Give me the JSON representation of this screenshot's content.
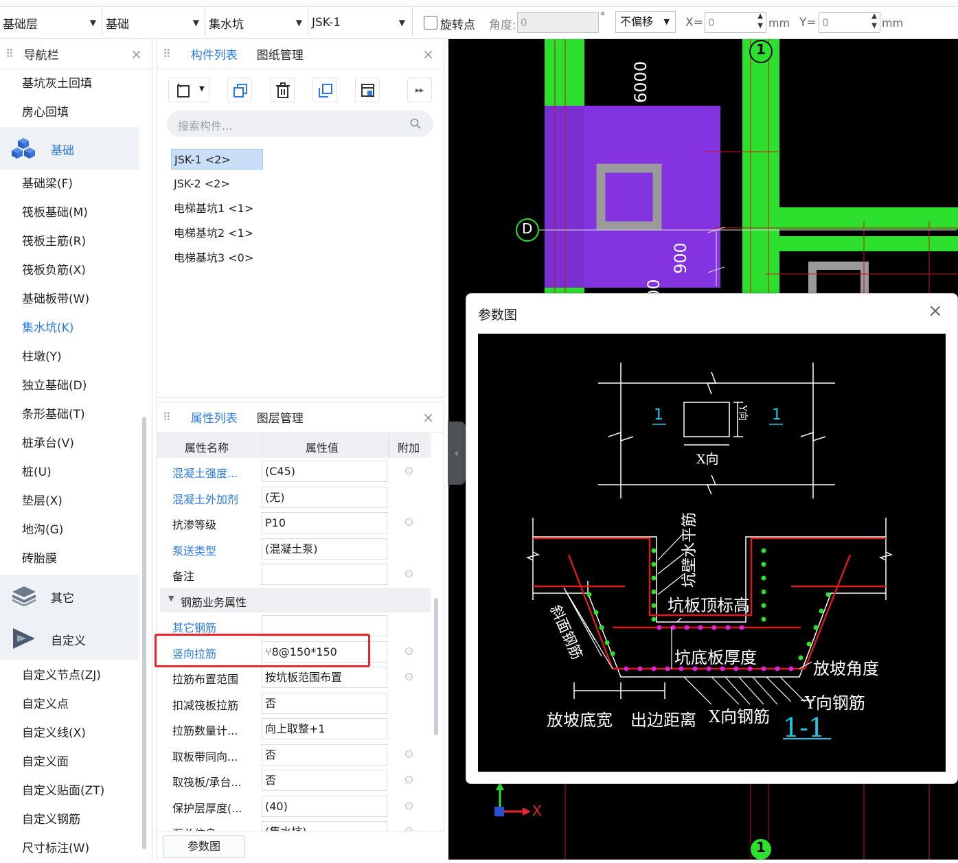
{
  "toolbar": {
    "floor": "基础层",
    "category": "基础",
    "type": "集水坑",
    "component": "JSK-1",
    "rotate_label": "旋转点",
    "angle_label": "角度:",
    "angle_value": "0",
    "degree_symbol": "°",
    "offset_mode": "不偏移",
    "x_label": "X=",
    "x_value": "0",
    "y_label": "Y=",
    "y_value": "0",
    "unit": "mm"
  },
  "nav": {
    "title": "导航栏",
    "items_top": [
      "基坑灰土回填",
      "房心回填"
    ],
    "group_foundation": "基础",
    "foundation_items": [
      "基础梁(F)",
      "筏板基础(M)",
      "筏板主筋(R)",
      "筏板负筋(X)",
      "基础板带(W)",
      "集水坑(K)",
      "柱墩(Y)",
      "独立基础(D)",
      "条形基础(T)",
      "桩承台(V)",
      "桩(U)",
      "垫层(X)",
      "地沟(G)",
      "砖胎膜"
    ],
    "selected_item": "集水坑(K)",
    "group_other": "其它",
    "group_custom": "自定义",
    "custom_items": [
      "自定义节点(ZJ)",
      "自定义点",
      "自定义线(X)",
      "自定义面",
      "自定义贴面(ZT)",
      "自定义钢筋",
      "尺寸标注(W)"
    ]
  },
  "components": {
    "tab_active": "构件列表",
    "tab_other": "图纸管理",
    "search_placeholder": "搜索构件...",
    "items": [
      "JSK-1 <2>",
      "JSK-2 <2>",
      "电梯基坑1 <1>",
      "电梯基坑2 <1>",
      "电梯基坑3 <0>"
    ]
  },
  "properties": {
    "tab_active": "属性列表",
    "tab_other": "图层管理",
    "col_name": "属性名称",
    "col_value": "属性值",
    "col_extra": "附加",
    "rows": [
      {
        "name": "混凝土强度...",
        "value": "(C45)",
        "link": true,
        "dot": true
      },
      {
        "name": "混凝土外加剂",
        "value": "(无)",
        "link": true,
        "dot": false
      },
      {
        "name": "抗渗等级",
        "value": "P10",
        "link": false,
        "dot": true
      },
      {
        "name": "泵送类型",
        "value": "(混凝土泵)",
        "link": true,
        "dot": false
      },
      {
        "name": "备注",
        "value": "",
        "link": false,
        "dot": true
      }
    ],
    "section": "钢筋业务属性",
    "rebar_rows": [
      {
        "name": "其它钢筋",
        "value": "",
        "link": true,
        "dot": false
      },
      {
        "name": "竖向拉筋",
        "value": "⑂8@150*150",
        "link": true,
        "dot": true
      },
      {
        "name": "拉筋布置范围",
        "value": "按坑板范围布置",
        "link": false,
        "dot": true
      },
      {
        "name": "扣减筏板拉筋",
        "value": "否",
        "link": false,
        "dot": false
      },
      {
        "name": "拉筋数量计...",
        "value": "向上取整+1",
        "link": false,
        "dot": false
      },
      {
        "name": "取板带同向...",
        "value": "否",
        "link": false,
        "dot": true
      },
      {
        "name": "取筏板/承台...",
        "value": "否",
        "link": false,
        "dot": true
      },
      {
        "name": "保护层厚度(...",
        "value": "(40)",
        "link": false,
        "dot": true
      },
      {
        "name": "汇总信息",
        "value": "(集水坑)",
        "link": false,
        "dot": true
      }
    ],
    "param_button": "参数图"
  },
  "cad": {
    "dim_6000": "6000",
    "dim_900": "900",
    "dim_partial": "00",
    "axis_d": "D",
    "axis_1": "1",
    "axis_x": "X"
  },
  "dialog": {
    "title": "参数图",
    "section_mark": "1",
    "x_dir": "X向",
    "y_dir": "Y向",
    "wall_horizontal": "坑壁水平筋",
    "top_elev": "坑板顶标高",
    "slope_rebar": "斜面钢筋",
    "bottom_thickness": "坑底板厚度",
    "slope_angle": "放坡角度",
    "y_rebar": "Y向钢筋",
    "slope_width": "放坡底宽",
    "edge_dist": "出边距离",
    "x_rebar": "X向钢筋",
    "section_title": "1-1"
  },
  "colors": {
    "accent": "#2a7be4",
    "highlight_box": "#e8262b",
    "cad_green": "#2ee02e",
    "cad_purple": "#7a2fd0",
    "cad_red": "#c81818"
  }
}
